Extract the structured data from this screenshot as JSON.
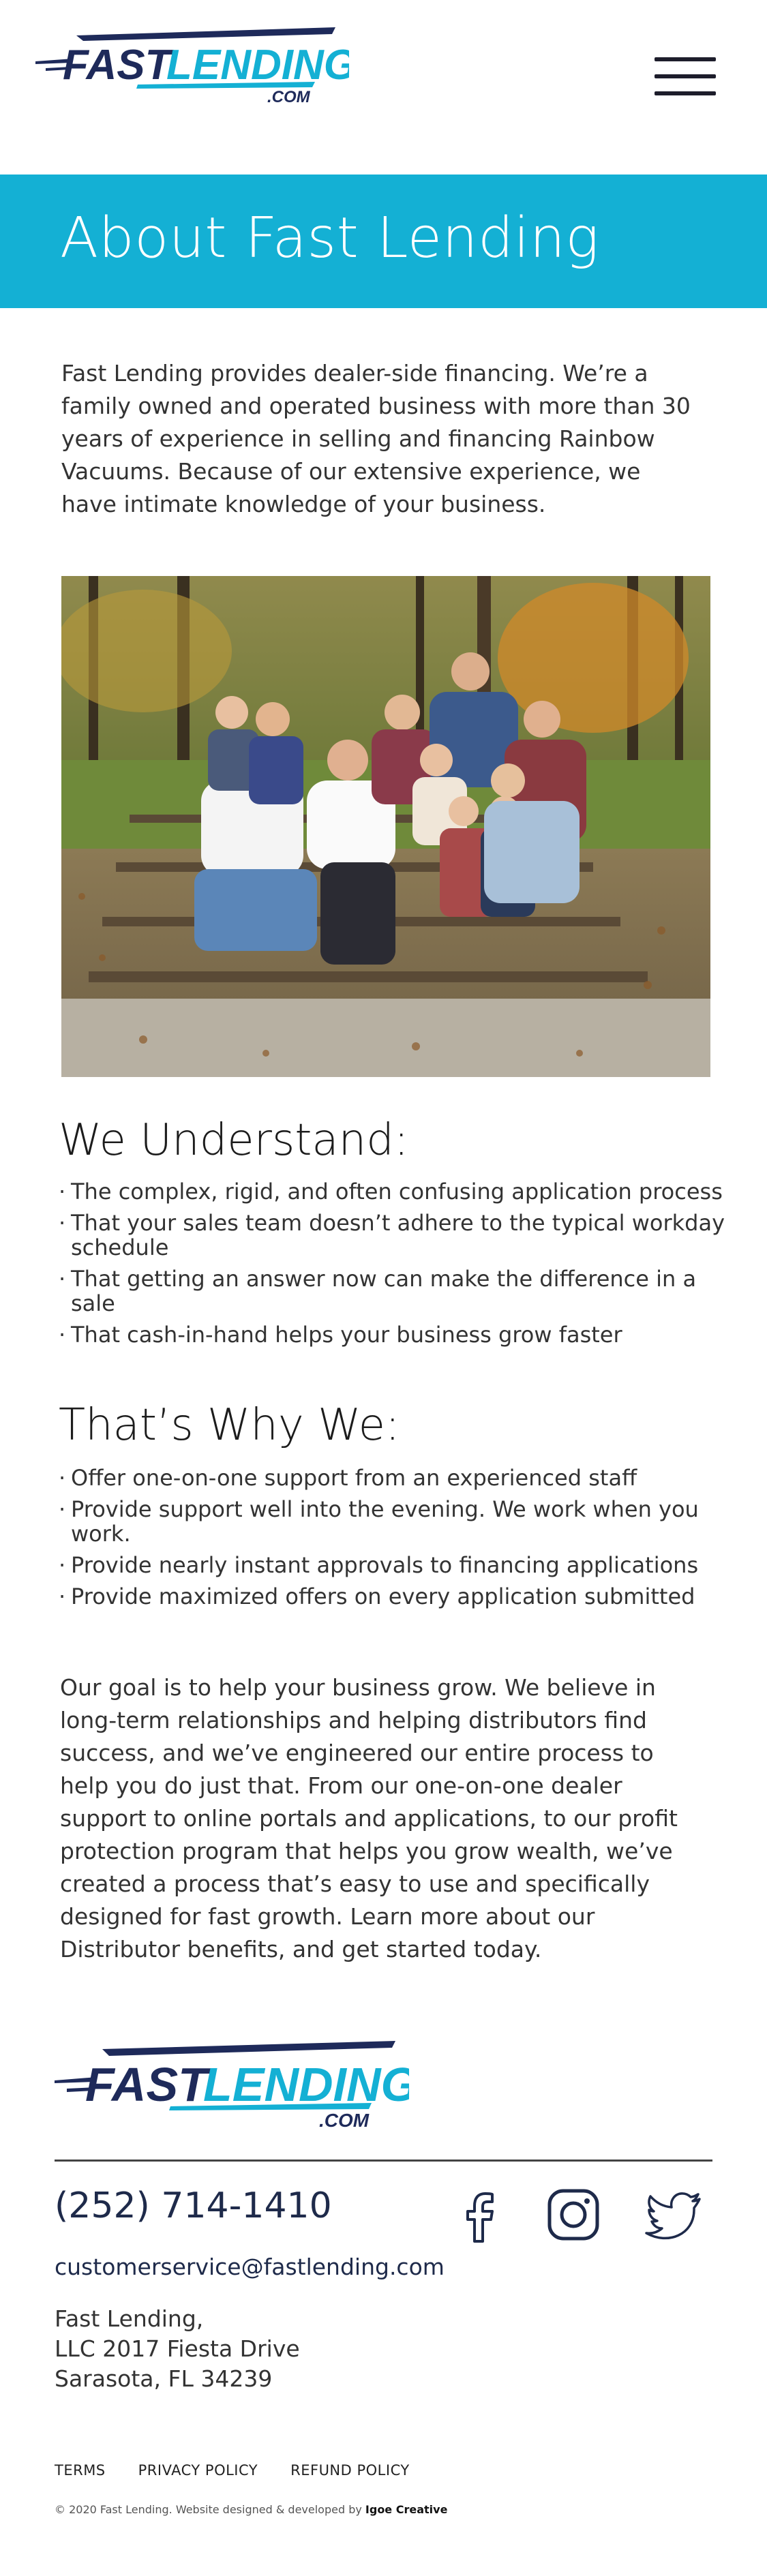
{
  "header": {
    "logo_text": "FASTLENDING",
    "logo_fast": "FAST",
    "logo_lending": "LENDING",
    "logo_suffix": ".COM",
    "menu_icon": "hamburger-menu-icon"
  },
  "banner": {
    "title": "About Fast Lending"
  },
  "intro": {
    "text": "Fast Lending provides dealer-side financing. We’re a family owned and operated business with more than 30 years of experience in selling and financing Rainbow Vacuums. Because of our extensive experience, we have intimate knowledge of your business."
  },
  "understand": {
    "heading": "We Understand:",
    "items": [
      "The complex, rigid, and often confusing application process",
      "That your sales team doesn’t adhere to the typical workday schedule",
      "That getting an answer now can make the difference in a sale",
      "That cash-in-hand helps your business grow faster"
    ]
  },
  "why": {
    "heading": "That’s Why We:",
    "items": [
      "Offer one-on-one support from an experienced staff",
      "Provide support well into the evening. We work when you work.",
      "Provide nearly instant approvals to financing applications",
      "Provide maximized offers on every application submitted"
    ]
  },
  "goal": {
    "text": "Our goal is to help your business grow. We believe in long-term relationships and helping distributors find success, and we’ve engineered our entire process to help you do just that. From our one-on-one dealer support to online portals and applications, to our profit protection program that helps you grow wealth, we’ve created a process that’s easy to use and specifically designed for fast growth. Learn more about our Distributor benefits, and get started today."
  },
  "footer": {
    "phone": "(252) 714-1410",
    "email": "customerservice@fastlending.com",
    "address_line1": "Fast Lending,",
    "address_line2": "LLC 2017 Fiesta Drive",
    "address_line3": "Sarasota, FL 34239",
    "links": [
      "TERMS",
      "PRIVACY POLICY",
      "REFUND POLICY"
    ],
    "copyright_prefix": "© 2020 Fast Lending. Website designed & developed by ",
    "copyright_studio": "Igoe Creative",
    "social": [
      "facebook-icon",
      "instagram-icon",
      "twitter-icon"
    ]
  },
  "colors": {
    "brand_navy": "#1e2a5a",
    "brand_cyan": "#14b0d4",
    "banner_bg": "#14b0d4"
  }
}
